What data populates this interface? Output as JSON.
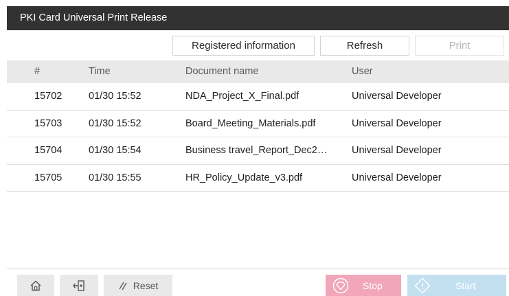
{
  "window": {
    "title": "PKI Card Universal Print Release"
  },
  "toolbar": {
    "registered_label": "Registered information",
    "refresh_label": "Refresh",
    "print_label": "Print"
  },
  "table": {
    "headers": {
      "num": "#",
      "time": "Time",
      "doc": "Document name",
      "user": "User"
    },
    "rows": [
      {
        "num": "15702",
        "time": "01/30 15:52",
        "doc": "NDA_Project_X_Final.pdf",
        "user": "Universal Developer"
      },
      {
        "num": "15703",
        "time": "01/30 15:52",
        "doc": "Board_Meeting_Materials.pdf",
        "user": "Universal Developer"
      },
      {
        "num": "15704",
        "time": "01/30 15:54",
        "doc": "Business travel_Report_Dec2…",
        "user": "Universal Developer"
      },
      {
        "num": "15705",
        "time": "01/30 15:55",
        "doc": "HR_Policy_Update_v3.pdf",
        "user": "Universal Developer"
      }
    ]
  },
  "bottom": {
    "home_icon": "home-icon",
    "logout_icon": "logout-icon",
    "reset_icon": "reset-icon",
    "reset_label": "Reset",
    "stop_icon": "stop-icon",
    "stop_label": "Stop",
    "start_icon": "start-icon",
    "start_label": "Start"
  },
  "colors": {
    "titlebar": "#323232",
    "stop": "#f1a6ba",
    "start": "#c3e0f1",
    "header_bg": "#e9e9e9"
  }
}
